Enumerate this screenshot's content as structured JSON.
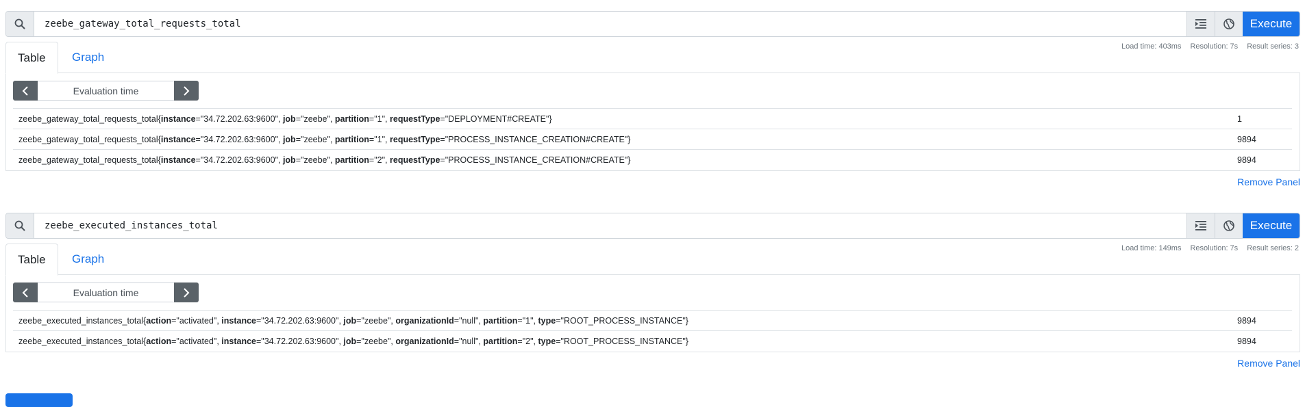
{
  "panels": [
    {
      "query": "zeebe_gateway_total_requests_total",
      "execute_label": "Execute",
      "tabs": {
        "table": "Table",
        "graph": "Graph"
      },
      "stats": {
        "load_time": "Load time: 403ms",
        "resolution": "Resolution: 7s",
        "result_series": "Result series: 3"
      },
      "evaluation_time_placeholder": "Evaluation time",
      "rows": [
        {
          "metric": "zeebe_gateway_total_requests_total",
          "labels": [
            [
              "instance",
              "34.72.202.63:9600"
            ],
            [
              "job",
              "zeebe"
            ],
            [
              "partition",
              "1"
            ],
            [
              "requestType",
              "DEPLOYMENT#CREATE"
            ]
          ],
          "value": "1"
        },
        {
          "metric": "zeebe_gateway_total_requests_total",
          "labels": [
            [
              "instance",
              "34.72.202.63:9600"
            ],
            [
              "job",
              "zeebe"
            ],
            [
              "partition",
              "1"
            ],
            [
              "requestType",
              "PROCESS_INSTANCE_CREATION#CREATE"
            ]
          ],
          "value": "9894"
        },
        {
          "metric": "zeebe_gateway_total_requests_total",
          "labels": [
            [
              "instance",
              "34.72.202.63:9600"
            ],
            [
              "job",
              "zeebe"
            ],
            [
              "partition",
              "2"
            ],
            [
              "requestType",
              "PROCESS_INSTANCE_CREATION#CREATE"
            ]
          ],
          "value": "9894"
        }
      ],
      "remove_label": "Remove Panel"
    },
    {
      "query": "zeebe_executed_instances_total",
      "execute_label": "Execute",
      "tabs": {
        "table": "Table",
        "graph": "Graph"
      },
      "stats": {
        "load_time": "Load time: 149ms",
        "resolution": "Resolution: 7s",
        "result_series": "Result series: 2"
      },
      "evaluation_time_placeholder": "Evaluation time",
      "rows": [
        {
          "metric": "zeebe_executed_instances_total",
          "labels": [
            [
              "action",
              "activated"
            ],
            [
              "instance",
              "34.72.202.63:9600"
            ],
            [
              "job",
              "zeebe"
            ],
            [
              "organizationId",
              "null"
            ],
            [
              "partition",
              "1"
            ],
            [
              "type",
              "ROOT_PROCESS_INSTANCE"
            ]
          ],
          "value": "9894"
        },
        {
          "metric": "zeebe_executed_instances_total",
          "labels": [
            [
              "action",
              "activated"
            ],
            [
              "instance",
              "34.72.202.63:9600"
            ],
            [
              "job",
              "zeebe"
            ],
            [
              "organizationId",
              "null"
            ],
            [
              "partition",
              "2"
            ],
            [
              "type",
              "ROOT_PROCESS_INSTANCE"
            ]
          ],
          "value": "9894"
        }
      ],
      "remove_label": "Remove Panel"
    }
  ],
  "colors": {
    "primary": "#1a73e8",
    "nav_button": "#5a6268"
  },
  "icons": {
    "search": "search-icon",
    "format": "indent-icon",
    "metrics": "globe-icon",
    "prev": "chevron-left-icon",
    "next": "chevron-right-icon"
  }
}
